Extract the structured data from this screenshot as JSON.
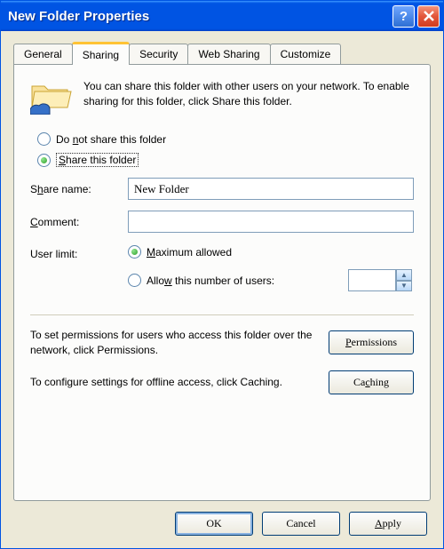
{
  "title": "New Folder Properties",
  "tabs": {
    "general": "General",
    "sharing": "Sharing",
    "security": "Security",
    "websharing": "Web Sharing",
    "customize": "Customize"
  },
  "intro": "You can share this folder with other users on your network.  To enable sharing for this folder, click Share this folder.",
  "radios": {
    "do_not_share_pre": "Do ",
    "do_not_share_u": "n",
    "do_not_share_post": "ot share this folder",
    "share_pre": "",
    "share_u": "S",
    "share_post": "hare this folder"
  },
  "share_name": {
    "label_pre": "S",
    "label_u": "h",
    "label_post": "are name:",
    "value": "New Folder"
  },
  "comment": {
    "label_u": "C",
    "label_post": "omment:",
    "value": ""
  },
  "user_limit": {
    "label": "User limit:",
    "max_u": "M",
    "max_post": "aximum allowed",
    "allow_pre": "Allo",
    "allow_u": "w",
    "allow_post": " this number of users:",
    "number": ""
  },
  "helpers": {
    "permissions_text": "To set permissions for users who access this folder over the network, click Permissions.",
    "permissions_btn_u": "P",
    "permissions_btn_post": "ermissions",
    "caching_text": "To configure settings for offline access, click Caching.",
    "caching_btn_pre": "Ca",
    "caching_btn_u": "c",
    "caching_btn_post": "hing"
  },
  "footer": {
    "ok": "OK",
    "cancel": "Cancel",
    "apply_u": "A",
    "apply_post": "pply"
  }
}
